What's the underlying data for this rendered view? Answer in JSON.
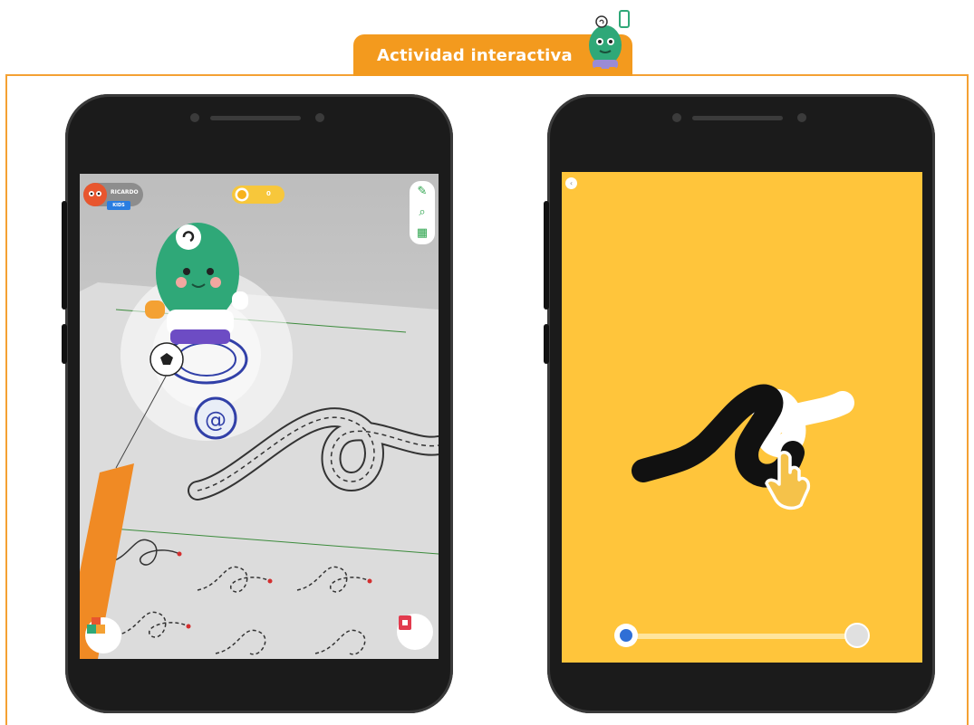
{
  "header": {
    "title": "Actividad interactiva"
  },
  "left_phone": {
    "user": {
      "name": "RICARDO",
      "badge": "KIDS"
    },
    "coins": {
      "value": "0"
    },
    "tools": [
      "pencil-icon",
      "search-icon",
      "book-icon"
    ],
    "worksheet_label": "Actividad interactiva"
  },
  "right_phone": {
    "slider": {
      "progress": 0
    }
  },
  "colors": {
    "accent": "#f39a1e",
    "mascot_green": "#2fa878",
    "activity_yellow": "#ffc53b",
    "slider_blue": "#2f6fd6"
  }
}
